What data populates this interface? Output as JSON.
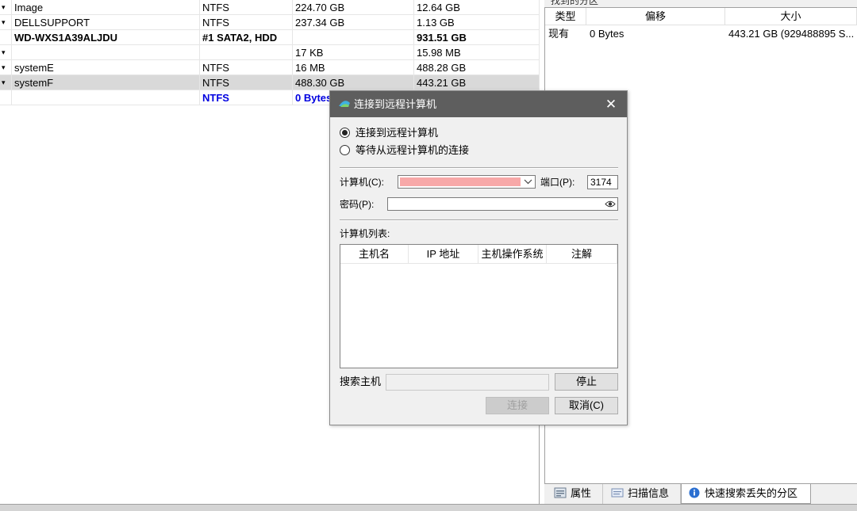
{
  "disk_table": {
    "rows": [
      {
        "toggle": "▾",
        "name": "Image",
        "fs": "NTFS",
        "c3": "224.70 GB",
        "c4": "12.64 GB",
        "style": ""
      },
      {
        "toggle": "▾",
        "name": "DELLSUPPORT",
        "fs": "NTFS",
        "c3": "237.34 GB",
        "c4": "1.13 GB",
        "style": ""
      },
      {
        "toggle": "",
        "name": "WD-WXS1A39ALJDU",
        "fs": "#1 SATA2, HDD",
        "c3": "",
        "c4": "931.51 GB",
        "style": "bold"
      },
      {
        "toggle": "▾",
        "name": "",
        "fs": "",
        "c3": "17 KB",
        "c4": "15.98 MB",
        "style": ""
      },
      {
        "toggle": "▾",
        "name": "systemE",
        "fs": "NTFS",
        "c3": "16 MB",
        "c4": "488.28 GB",
        "style": ""
      },
      {
        "toggle": "▾",
        "name": "systemF",
        "fs": "NTFS",
        "c3": "488.30 GB",
        "c4": "443.21 GB",
        "style": "selected"
      },
      {
        "toggle": "",
        "name": "",
        "fs": "NTFS",
        "c3": "0 Bytes",
        "c4": "",
        "style": "blue"
      }
    ]
  },
  "partition_panel": {
    "header_strip": "找到的分区",
    "columns": [
      "类型",
      "偏移",
      "大小"
    ],
    "rows": [
      {
        "type": "现有",
        "offset": "0 Bytes",
        "size": "443.21 GB (929488895 S..."
      }
    ]
  },
  "tabs": [
    {
      "label": "属性",
      "icon": "properties-icon"
    },
    {
      "label": "扫描信息",
      "icon": "scan-info-icon"
    },
    {
      "label": "快速搜索丢失的分区",
      "icon": "info-icon"
    }
  ],
  "dialog": {
    "title": "连接到远程计算机",
    "close_glyph": "✕",
    "radio_connect": "连接到远程计算机",
    "radio_wait": "等待从远程计算机的连接",
    "computer_label": "计算机(C):",
    "port_label": "端口(P):",
    "port_value": "3174",
    "password_label": "密码(P):",
    "list_label": "计算机列表:",
    "list_columns": [
      "主机名",
      "IP 地址",
      "主机操作系统",
      "注解"
    ],
    "search_label": "搜索主机",
    "stop_button": "停止",
    "connect_button": "连接",
    "cancel_button": "取消(C)"
  },
  "colors": {
    "titlebar": "#5e5e5e",
    "blue_text": "#0000e0",
    "computer_field_fill": "#f7a8a8",
    "selected_row": "#d9d9d9"
  }
}
